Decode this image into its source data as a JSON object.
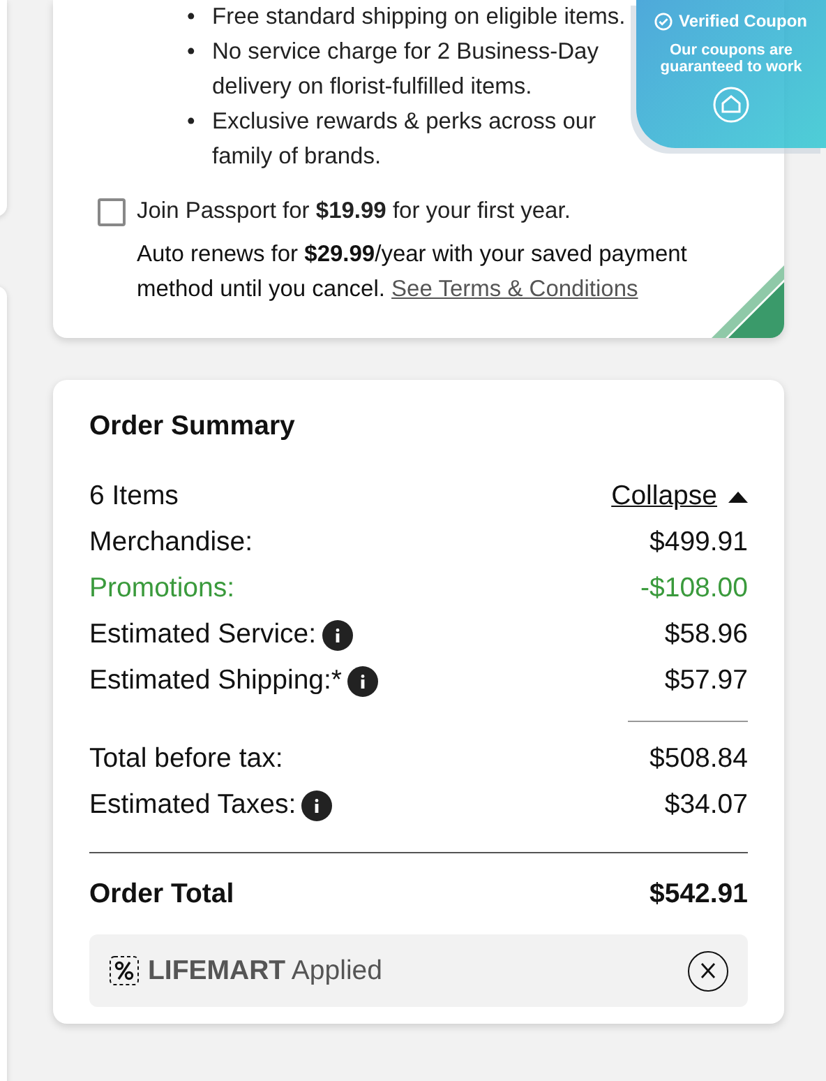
{
  "passport": {
    "benefits": [
      {
        "bullet": "•",
        "text": "Free standard shipping on eligible items."
      },
      {
        "bullet": "•",
        "text": "No service charge for 2 Business-Day delivery on florist-fulfilled items."
      },
      {
        "bullet": "•",
        "text": "Exclusive rewards & perks across our family of brands."
      }
    ],
    "join": {
      "label": "Join Passport for **$19.99** for your first year.",
      "checked": false
    },
    "renewal": "Auto renews for **$29.99**/year with your saved payment method until you cancel.",
    "terms_link": "See Terms & Conditions"
  },
  "badge": {
    "title": "Verified Coupon",
    "subtitle": "Our coupons are guaranteed to work"
  },
  "order_summary": {
    "title": "Order Summary",
    "items_count": "6 Items",
    "toggle": "Collapse",
    "expanded": true,
    "lines": [
      {
        "kind": "plain",
        "label": "Merchandise:",
        "value": "$499.91",
        "info": false
      },
      {
        "kind": "promo",
        "label": "Promotions:",
        "value": "-$108.00",
        "info": false
      },
      {
        "kind": "plain",
        "label": "Estimated Service:",
        "value": "$58.96",
        "info": true
      },
      {
        "kind": "plain",
        "label": "Estimated Shipping:*",
        "value": "$57.97",
        "info": true
      },
      {
        "kind": "subtotal",
        "label": "Total before tax:",
        "value": "$508.84",
        "info": false
      },
      {
        "kind": "plain",
        "label": "Estimated Taxes:",
        "value": "$34.07",
        "info": true
      }
    ],
    "total": {
      "label": "Order Total",
      "value": "$542.91"
    },
    "coupon": {
      "code": "LIFEMART",
      "status": "Applied"
    }
  }
}
